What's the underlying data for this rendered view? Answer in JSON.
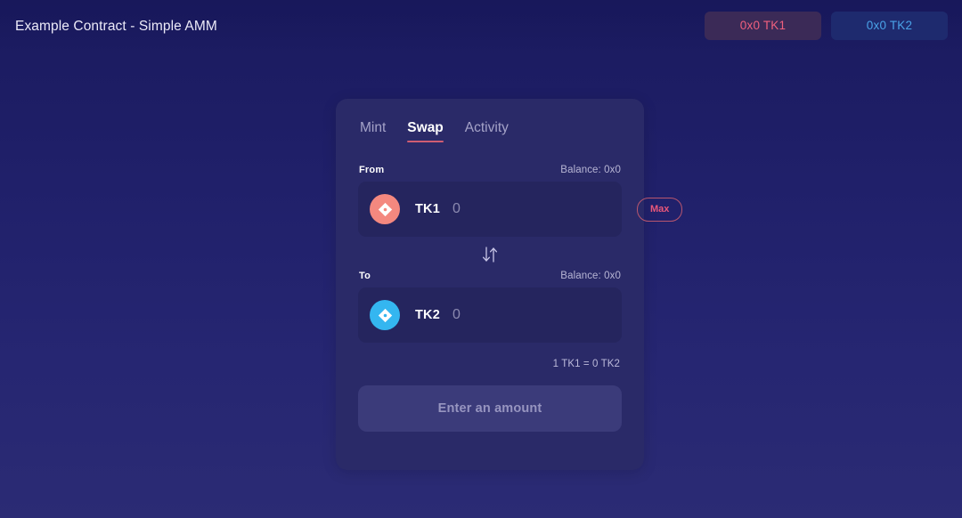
{
  "header": {
    "title": "Example Contract - Simple AMM",
    "chips": [
      {
        "label": "0x0 TK1",
        "variant": "tk1",
        "name": "tk1-balance-chip"
      },
      {
        "label": "0x0 TK2",
        "variant": "tk2",
        "name": "tk2-balance-chip"
      }
    ]
  },
  "card": {
    "tabs": [
      {
        "label": "Mint",
        "active": false
      },
      {
        "label": "Swap",
        "active": true
      },
      {
        "label": "Activity",
        "active": false
      }
    ],
    "from": {
      "label": "From",
      "balance": "Balance: 0x0",
      "token_symbol": "TK1",
      "token_icon": "diamond-token-icon",
      "amount_value": "",
      "amount_placeholder": "0",
      "max_label": "Max"
    },
    "swap_direction_icon": "swap-vertical-arrows-icon",
    "to": {
      "label": "To",
      "balance": "Balance: 0x0",
      "token_symbol": "TK2",
      "token_icon": "diamond-token-icon",
      "amount_value": "",
      "amount_placeholder": "0"
    },
    "rate": "1 TK1 = 0 TK2",
    "action_label": "Enter an amount"
  },
  "colors": {
    "page_bg_top": "#1a1a5e",
    "page_bg_bottom": "#2b2b74",
    "card_bg": "#2a2a68",
    "row_bg": "#25255e",
    "accent_pink": "#e8577a",
    "accent_blue": "#4aa3e8",
    "tk1_icon": "#f4887f",
    "tk2_icon": "#34b6f0",
    "tab_underline": "#cf5d72",
    "action_bg": "#3b3b7a"
  }
}
